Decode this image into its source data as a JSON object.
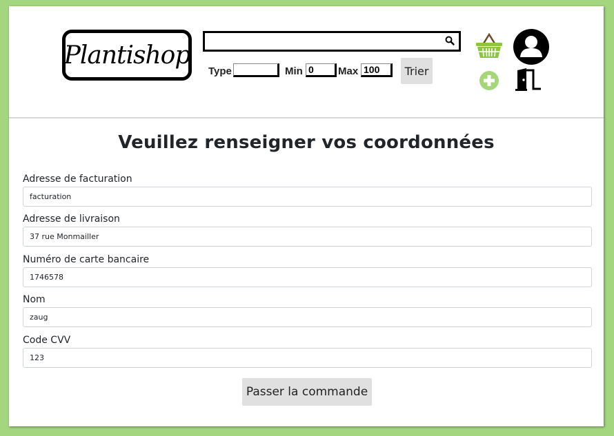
{
  "header": {
    "logo_text": "Plantishop",
    "search": {
      "value": "",
      "placeholder": ""
    },
    "filters": {
      "type_label": "Type",
      "type_value": "",
      "min_label": "Min",
      "min_value": "0",
      "max_label": "Max",
      "max_value": "100"
    },
    "sort_button": "Trier",
    "icons": {
      "search": "search-icon",
      "basket": "basket-icon",
      "account": "user-account-icon",
      "add": "add-plus-icon",
      "logout": "logout-door-icon"
    },
    "colors": {
      "accent_green": "#8cc63f",
      "page_background": "#a3d67f"
    }
  },
  "form": {
    "title": "Veuillez renseigner vos coordonnées",
    "fields": [
      {
        "label": "Adresse de facturation",
        "value": "facturation"
      },
      {
        "label": "Adresse de livraison",
        "value": "37 rue Monmailler"
      },
      {
        "label": "Numéro de carte bancaire",
        "value": "1746578"
      },
      {
        "label": "Nom",
        "value": "zaug"
      },
      {
        "label": "Code CVV",
        "value": "123"
      }
    ],
    "submit_label": "Passer la commande"
  }
}
